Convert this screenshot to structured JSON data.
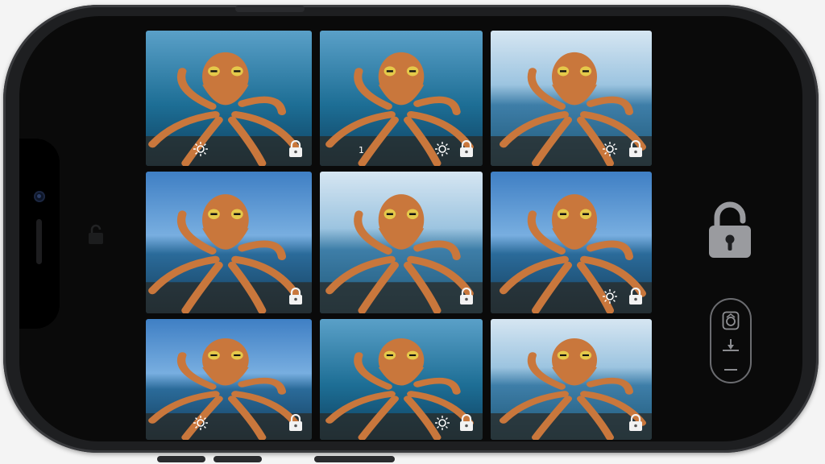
{
  "device": {
    "frame_color": "#1e1f21",
    "screen_color": "#0a0a0a"
  },
  "gallery": {
    "tiles": [
      {
        "id": "tile-1",
        "locked": true,
        "badge_icon": "sun-icon",
        "badge_text": ""
      },
      {
        "id": "tile-2",
        "locked": true,
        "badge_icon": "sun-icon",
        "badge_text": "1"
      },
      {
        "id": "tile-3",
        "locked": true,
        "badge_icon": "sun-icon",
        "badge_text": ""
      },
      {
        "id": "tile-4",
        "locked": true,
        "badge_icon": "",
        "badge_text": ""
      },
      {
        "id": "tile-5",
        "locked": true,
        "badge_icon": "",
        "badge_text": ""
      },
      {
        "id": "tile-6",
        "locked": true,
        "badge_icon": "sun-icon",
        "badge_text": ""
      },
      {
        "id": "tile-7",
        "locked": true,
        "badge_icon": "sun-icon",
        "badge_text": ""
      },
      {
        "id": "tile-8",
        "locked": true,
        "badge_icon": "sun-icon",
        "badge_text": ""
      },
      {
        "id": "tile-9",
        "locked": true,
        "badge_icon": "",
        "badge_text": ""
      }
    ],
    "subject": "octopus"
  },
  "controls": {
    "unlock_icon": "unlock-icon",
    "shutter_icon": "camera-shutter-icon",
    "slider_icon": "exposure-slider-icon"
  },
  "colors": {
    "accent_gray": "#8e8f93",
    "octopus": "#c9773c"
  }
}
